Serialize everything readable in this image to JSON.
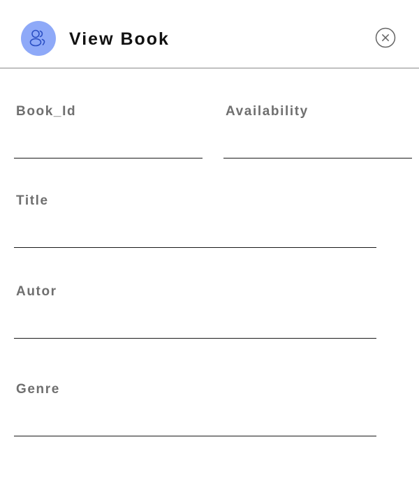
{
  "header": {
    "title": "View Book",
    "avatar_icon": "users-icon",
    "close_icon": "close-circle-icon",
    "avatar_color": "#8ea9f8",
    "avatar_icon_color": "#2b4fc4"
  },
  "form": {
    "book_id": {
      "label": "Book_Id",
      "value": ""
    },
    "availability": {
      "label": "Availability",
      "value": ""
    },
    "title": {
      "label": "Title",
      "value": ""
    },
    "autor": {
      "label": "Autor",
      "value": ""
    },
    "genre": {
      "label": "Genre",
      "value": ""
    }
  }
}
